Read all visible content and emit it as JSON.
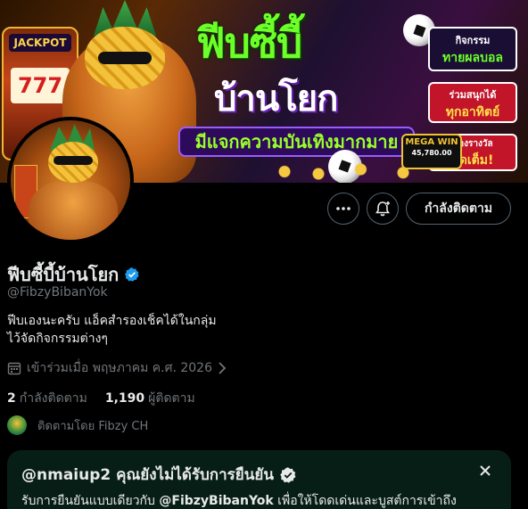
{
  "banner": {
    "title_main": "ฟีบซี้บี้",
    "title_sub": "บ้านโยก",
    "title_strip": "มีแจกความบันเทิงมากมาย",
    "slot_label": "JACKPOT",
    "slot_reels": "777",
    "box1_small": "กิจกรรม",
    "box1_big": "ทายผลบอล",
    "box2_small": "ร่วมสนุกได้",
    "box2_big": "ทุกอาทิตย์",
    "box3_small": "ของรางวัล",
    "box3_big": "จัดเต็ม!",
    "mega_label": "MEGA WIN",
    "mega_amount": "45,780.00"
  },
  "actions": {
    "more_icon": "ellipsis-icon",
    "notify_icon": "bell-plus-icon",
    "follow_label": "กำลังติดตาม"
  },
  "profile": {
    "display_name": "ฟีบซี้บี้บ้านโยก",
    "handle": "@FibzyBibanYok",
    "bio_line1": "ฟีบเองนะครับ แอ็คสำรองเช็คได้ในกลุ่ม",
    "bio_line2": "ไว้จัดกิจกรรมต่างๆ",
    "joined": "เข้าร่วมเมื่อ พฤษภาคม ค.ศ. 2026",
    "following_count": "2",
    "following_label": "กำลังติดตาม",
    "followers_count": "1,190",
    "followers_label": "ผู้ติดตาม",
    "followed_by": "ติดตามโดย Fibzy CH"
  },
  "verify_banner": {
    "title": "@nmaiup2 คุณยังไม่ได้รับการยืนยัน",
    "text_before": "รับการยืนยันแบบเดียวกับ ",
    "text_handle": "@FibzyBibanYok",
    "text_after": " เพื่อให้โดดเด่นและบูสต์การเข้าถึง"
  },
  "colors": {
    "background": "#000000",
    "text_primary": "#e7e9ea",
    "text_secondary": "#71767b",
    "verified_blue": "#1d9bf0",
    "verify_banner_bg": "#071e16"
  }
}
